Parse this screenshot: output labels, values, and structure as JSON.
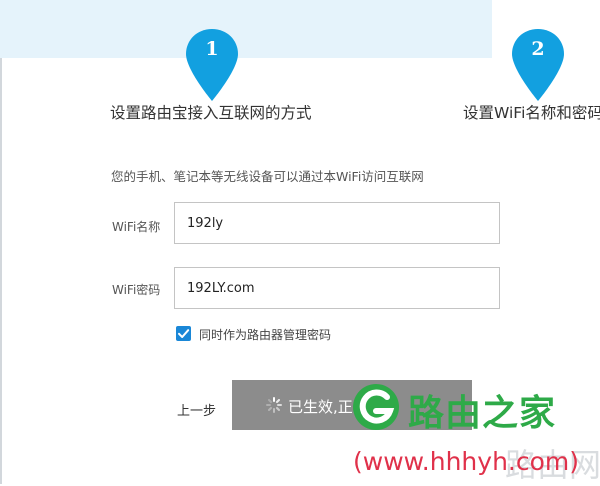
{
  "steps": [
    {
      "number": "1",
      "label": "设置路由宝接入互联网的方式"
    },
    {
      "number": "2",
      "label": "设置WiFi名称和密码"
    }
  ],
  "hint": "您的手机、笔记本等无线设备可以通过本WiFi访问互联网",
  "fields": {
    "ssid": {
      "label": "WiFi名称",
      "value": "192ly"
    },
    "password": {
      "label": "WiFi密码",
      "value": "192LY.com"
    }
  },
  "checkbox": {
    "label": "同时作为路由器管理密码",
    "checked": true
  },
  "actions": {
    "prev_label": "上一步",
    "submit_label": "已生效,正在重启",
    "submit_state": "loading"
  },
  "watermark": {
    "brand": "路由之家",
    "url": "(www.hhhyh.com)"
  },
  "colors": {
    "accent": "#1a87d7",
    "marker": "#12a0e0",
    "band": "#e5f3fb",
    "button_disabled": "#8c8c8c",
    "watermark_green": "#2eaa48",
    "watermark_red": "#e0314a"
  },
  "icons": {
    "marker": "map-pin-icon",
    "spinner": "loading-spinner-icon",
    "checkbox": "checkmark-icon",
    "watermark_logo": "router-logo-icon"
  }
}
